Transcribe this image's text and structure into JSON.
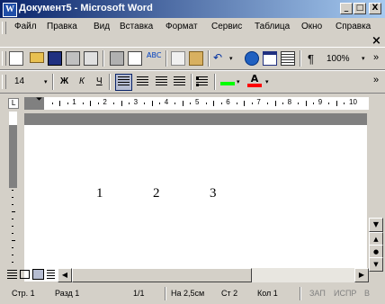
{
  "window": {
    "title": "Документ5 - Microsoft Word",
    "app_icon_letter": "W",
    "minimize": "_",
    "maximize": "□",
    "close": "X"
  },
  "menu": {
    "items": [
      "Файл",
      "Правка",
      "Вид",
      "Вставка",
      "Формат",
      "Сервис",
      "Таблица",
      "Окно",
      "Справка"
    ],
    "close_doc": "×"
  },
  "toolbar": {
    "zoom": "100%",
    "font_size": "14",
    "bold": "Ж",
    "italic": "К",
    "underline": "Ч",
    "paragraph_mark": "¶",
    "more": "»"
  },
  "colors": {
    "titlebar_start": "#0a246a",
    "titlebar_end": "#a6caf0",
    "highlight": "#00ff00",
    "font_color": "#ff0000"
  },
  "ruler": {
    "numbers": [
      "1",
      "2",
      "3",
      "4",
      "5",
      "6",
      "7",
      "8",
      "9",
      "10"
    ]
  },
  "document": {
    "text_items": [
      "1",
      "2",
      "3"
    ]
  },
  "statusbar": {
    "page": "Стр. 1",
    "section": "Разд 1",
    "pages": "1/1",
    "position": "На 2,5см",
    "line": "Ст 2",
    "column": "Кол 1",
    "rec": "ЗАП",
    "trk": "ИСПР",
    "ext": "В"
  }
}
